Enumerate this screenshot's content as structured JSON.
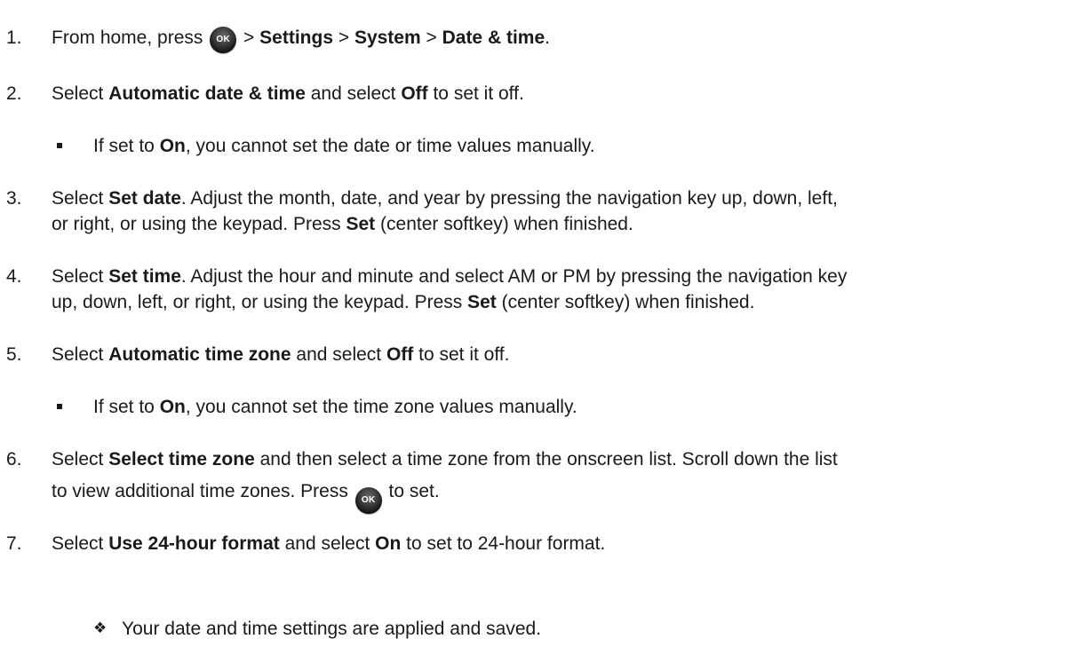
{
  "ok_icon_label": "OK",
  "diamond_glyph": "❖",
  "steps": [
    {
      "num": "1.",
      "parts": [
        "From home, press ",
        " > ",
        "Settings",
        " > ",
        "System",
        " > ",
        "Date & time",
        "."
      ]
    },
    {
      "num": "2.",
      "parts": [
        "Select ",
        "Automatic date & time",
        " and select ",
        "Off",
        " to set it off."
      ]
    },
    {
      "num": "3.",
      "parts": [
        "Select ",
        "Set date",
        ". Adjust the month, date, and year by pressing the navigation key up, down, left,",
        "or right, or using the keypad. Press ",
        "Set",
        " (center softkey) when finished."
      ]
    },
    {
      "num": "4.",
      "parts": [
        "Select ",
        "Set time",
        ". Adjust the hour and minute and select AM or PM by pressing the navigation key",
        "up, down, left, or right, or using the keypad. Press ",
        "Set",
        " (center softkey) when finished."
      ]
    },
    {
      "num": "5.",
      "parts": [
        "Select ",
        "Automatic time zone",
        " and select ",
        "Off",
        " to set it off."
      ]
    },
    {
      "num": "6.",
      "parts": [
        "Select ",
        "Select time zone",
        " and then select a time zone from the onscreen list. Scroll down the list",
        "to view additional time zones. Press ",
        " to set."
      ]
    },
    {
      "num": "7.",
      "parts": [
        "Select ",
        "Use 24-hour format",
        " and select ",
        "On",
        " to set to 24-hour format."
      ]
    }
  ],
  "notes": [
    {
      "parts": [
        "If set to ",
        "On",
        ", you cannot set the date or time values manually."
      ]
    },
    {
      "parts": [
        "If set to ",
        "On",
        ", you cannot set the time zone values manually."
      ]
    }
  ],
  "result": "Your date and time settings are applied and saved."
}
